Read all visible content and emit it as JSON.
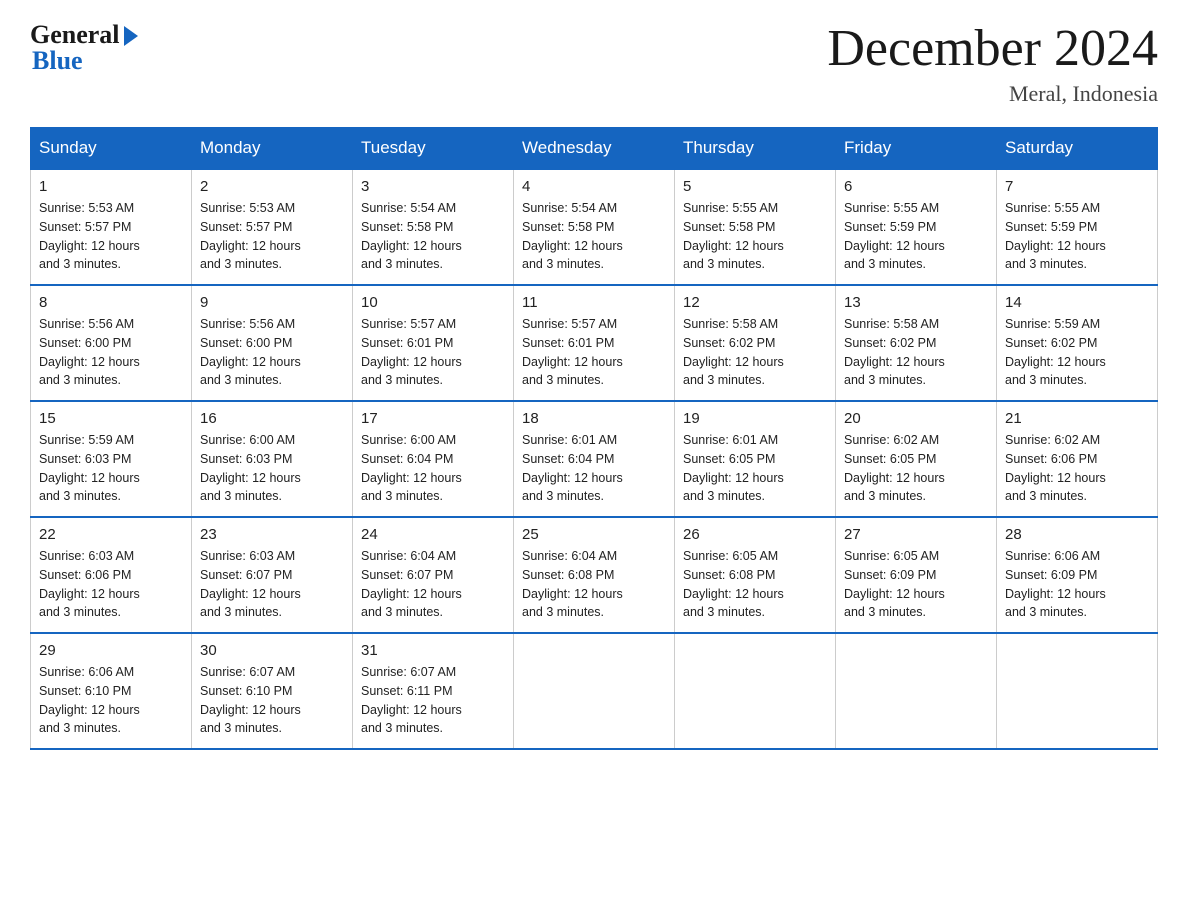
{
  "header": {
    "logo_general": "General",
    "logo_blue": "Blue",
    "month_title": "December 2024",
    "location": "Meral, Indonesia"
  },
  "days_of_week": [
    "Sunday",
    "Monday",
    "Tuesday",
    "Wednesday",
    "Thursday",
    "Friday",
    "Saturday"
  ],
  "weeks": [
    [
      {
        "day": "1",
        "sunrise": "5:53 AM",
        "sunset": "5:57 PM",
        "daylight": "12 hours and 3 minutes."
      },
      {
        "day": "2",
        "sunrise": "5:53 AM",
        "sunset": "5:57 PM",
        "daylight": "12 hours and 3 minutes."
      },
      {
        "day": "3",
        "sunrise": "5:54 AM",
        "sunset": "5:58 PM",
        "daylight": "12 hours and 3 minutes."
      },
      {
        "day": "4",
        "sunrise": "5:54 AM",
        "sunset": "5:58 PM",
        "daylight": "12 hours and 3 minutes."
      },
      {
        "day": "5",
        "sunrise": "5:55 AM",
        "sunset": "5:58 PM",
        "daylight": "12 hours and 3 minutes."
      },
      {
        "day": "6",
        "sunrise": "5:55 AM",
        "sunset": "5:59 PM",
        "daylight": "12 hours and 3 minutes."
      },
      {
        "day": "7",
        "sunrise": "5:55 AM",
        "sunset": "5:59 PM",
        "daylight": "12 hours and 3 minutes."
      }
    ],
    [
      {
        "day": "8",
        "sunrise": "5:56 AM",
        "sunset": "6:00 PM",
        "daylight": "12 hours and 3 minutes."
      },
      {
        "day": "9",
        "sunrise": "5:56 AM",
        "sunset": "6:00 PM",
        "daylight": "12 hours and 3 minutes."
      },
      {
        "day": "10",
        "sunrise": "5:57 AM",
        "sunset": "6:01 PM",
        "daylight": "12 hours and 3 minutes."
      },
      {
        "day": "11",
        "sunrise": "5:57 AM",
        "sunset": "6:01 PM",
        "daylight": "12 hours and 3 minutes."
      },
      {
        "day": "12",
        "sunrise": "5:58 AM",
        "sunset": "6:02 PM",
        "daylight": "12 hours and 3 minutes."
      },
      {
        "day": "13",
        "sunrise": "5:58 AM",
        "sunset": "6:02 PM",
        "daylight": "12 hours and 3 minutes."
      },
      {
        "day": "14",
        "sunrise": "5:59 AM",
        "sunset": "6:02 PM",
        "daylight": "12 hours and 3 minutes."
      }
    ],
    [
      {
        "day": "15",
        "sunrise": "5:59 AM",
        "sunset": "6:03 PM",
        "daylight": "12 hours and 3 minutes."
      },
      {
        "day": "16",
        "sunrise": "6:00 AM",
        "sunset": "6:03 PM",
        "daylight": "12 hours and 3 minutes."
      },
      {
        "day": "17",
        "sunrise": "6:00 AM",
        "sunset": "6:04 PM",
        "daylight": "12 hours and 3 minutes."
      },
      {
        "day": "18",
        "sunrise": "6:01 AM",
        "sunset": "6:04 PM",
        "daylight": "12 hours and 3 minutes."
      },
      {
        "day": "19",
        "sunrise": "6:01 AM",
        "sunset": "6:05 PM",
        "daylight": "12 hours and 3 minutes."
      },
      {
        "day": "20",
        "sunrise": "6:02 AM",
        "sunset": "6:05 PM",
        "daylight": "12 hours and 3 minutes."
      },
      {
        "day": "21",
        "sunrise": "6:02 AM",
        "sunset": "6:06 PM",
        "daylight": "12 hours and 3 minutes."
      }
    ],
    [
      {
        "day": "22",
        "sunrise": "6:03 AM",
        "sunset": "6:06 PM",
        "daylight": "12 hours and 3 minutes."
      },
      {
        "day": "23",
        "sunrise": "6:03 AM",
        "sunset": "6:07 PM",
        "daylight": "12 hours and 3 minutes."
      },
      {
        "day": "24",
        "sunrise": "6:04 AM",
        "sunset": "6:07 PM",
        "daylight": "12 hours and 3 minutes."
      },
      {
        "day": "25",
        "sunrise": "6:04 AM",
        "sunset": "6:08 PM",
        "daylight": "12 hours and 3 minutes."
      },
      {
        "day": "26",
        "sunrise": "6:05 AM",
        "sunset": "6:08 PM",
        "daylight": "12 hours and 3 minutes."
      },
      {
        "day": "27",
        "sunrise": "6:05 AM",
        "sunset": "6:09 PM",
        "daylight": "12 hours and 3 minutes."
      },
      {
        "day": "28",
        "sunrise": "6:06 AM",
        "sunset": "6:09 PM",
        "daylight": "12 hours and 3 minutes."
      }
    ],
    [
      {
        "day": "29",
        "sunrise": "6:06 AM",
        "sunset": "6:10 PM",
        "daylight": "12 hours and 3 minutes."
      },
      {
        "day": "30",
        "sunrise": "6:07 AM",
        "sunset": "6:10 PM",
        "daylight": "12 hours and 3 minutes."
      },
      {
        "day": "31",
        "sunrise": "6:07 AM",
        "sunset": "6:11 PM",
        "daylight": "12 hours and 3 minutes."
      },
      null,
      null,
      null,
      null
    ]
  ],
  "labels": {
    "sunrise": "Sunrise:",
    "sunset": "Sunset:",
    "daylight": "Daylight:"
  }
}
